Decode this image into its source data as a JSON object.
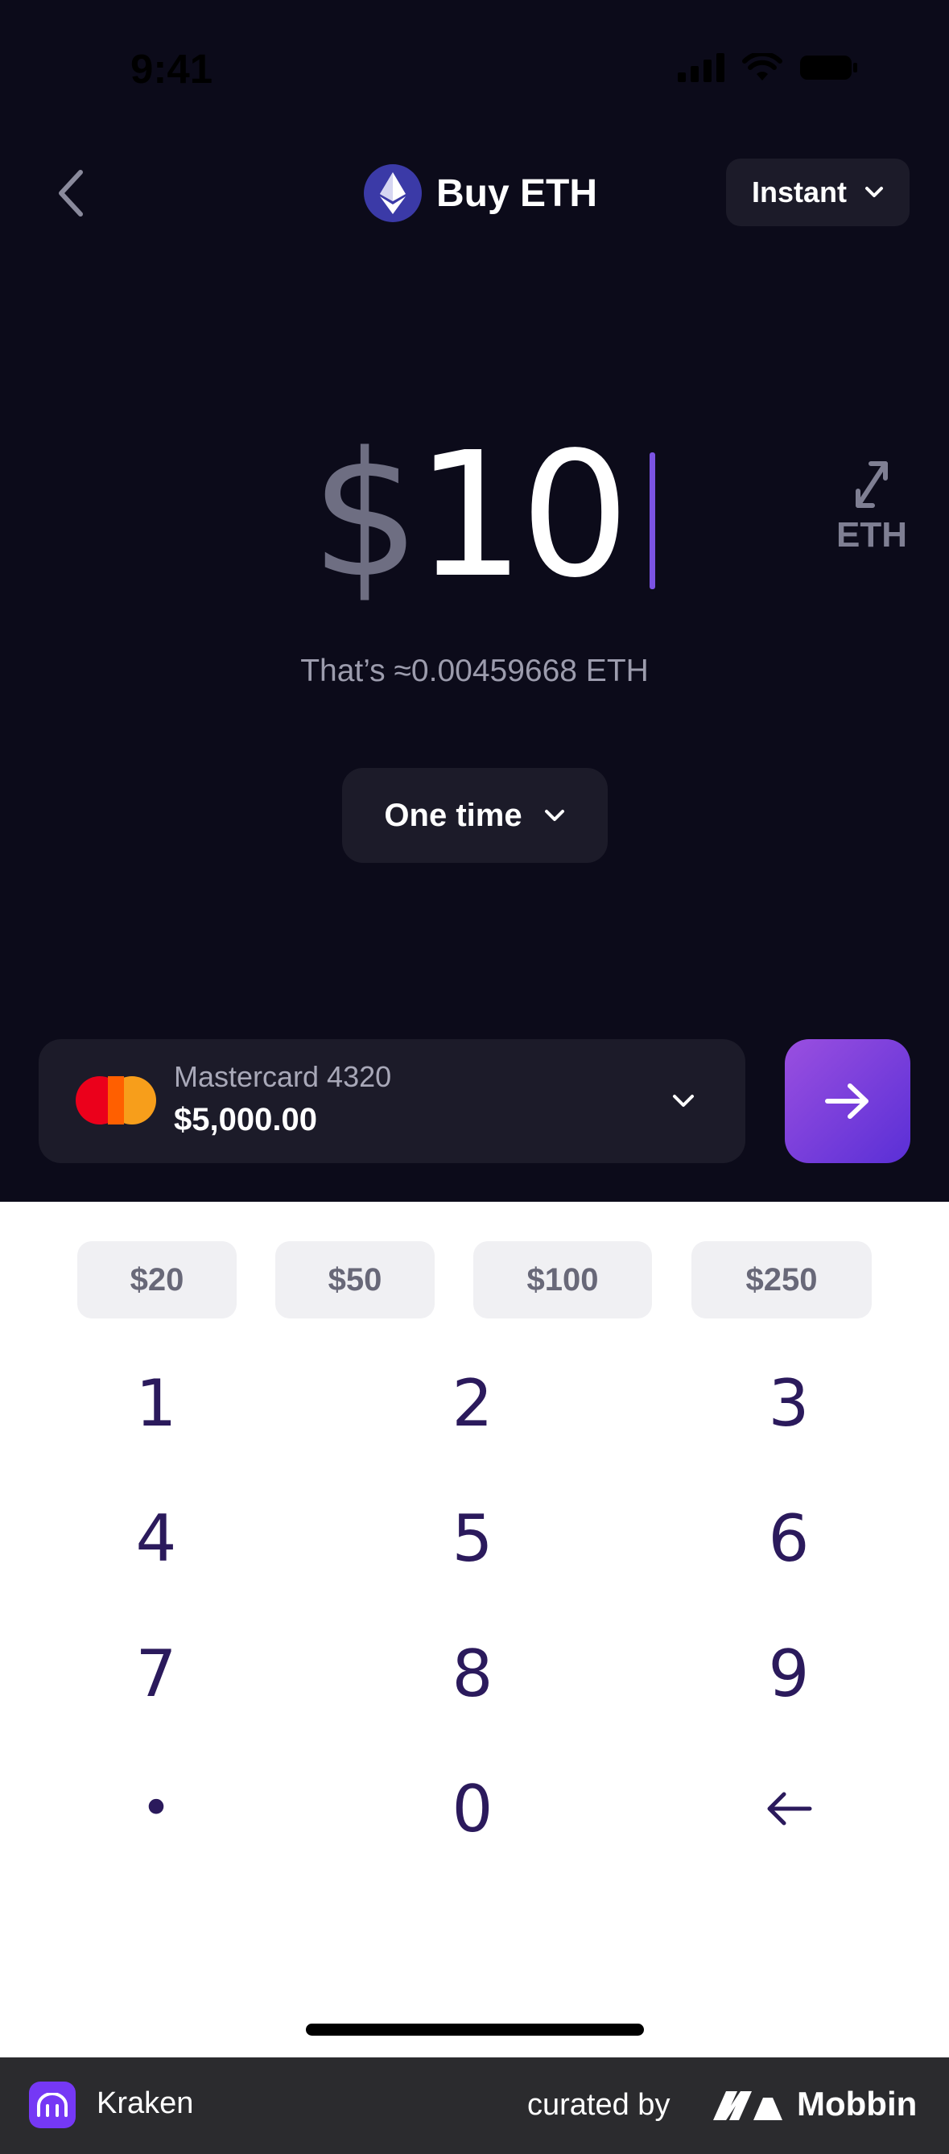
{
  "status_bar": {
    "time": "9:41"
  },
  "header": {
    "title": "Buy ETH",
    "order_type": "Instant"
  },
  "amount": {
    "currency_symbol": "$",
    "value": "10",
    "toggle_unit": "ETH",
    "equivalent": "That’s ≈0.00459668 ETH"
  },
  "frequency": {
    "label": "One time"
  },
  "payment": {
    "method": "Mastercard 4320",
    "balance": "$5,000.00"
  },
  "quick_amounts": [
    "$20",
    "$50",
    "$100",
    "$250"
  ],
  "keypad": [
    "1",
    "2",
    "3",
    "4",
    "5",
    "6",
    "7",
    "8",
    "9",
    "•",
    "0"
  ],
  "footer": {
    "app_name": "Kraken",
    "curated_by": "curated by",
    "brand": "Mobbin"
  },
  "colors": {
    "background_dark": "#0c0b1a",
    "card": "#1c1b29",
    "accent": "#7b53e3",
    "keypad_text": "#2b1a5c"
  },
  "icons": [
    "back-chevron-icon",
    "ethereum-icon",
    "chevron-down-icon",
    "swap-arrows-icon",
    "mastercard-icon",
    "arrow-right-icon",
    "backspace-arrow-icon",
    "kraken-logo-icon",
    "mobbin-logo-icon"
  ]
}
